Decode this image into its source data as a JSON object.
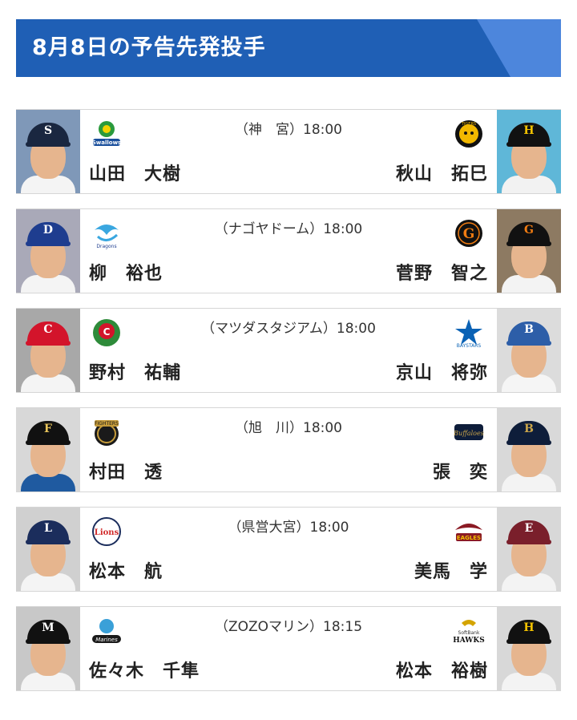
{
  "header": {
    "title": "8月8日の予告先発投手"
  },
  "games": [
    {
      "venue": "（神　宮）18:00",
      "home": {
        "pitcher": "山田　大樹",
        "team_icon": "swallows-logo-icon",
        "cap": "#1a2740",
        "cap_mark": "S",
        "mark": "#ffffff",
        "shirt": "#f4f4f4",
        "bg": "#7f98b8",
        "logo_color": "#2a9a3c"
      },
      "away": {
        "pitcher": "秋山　拓巳",
        "team_icon": "tigers-logo-icon",
        "cap": "#111111",
        "cap_mark": "H",
        "mark": "#f2c200",
        "shirt": "#f2f2f2",
        "bg": "#5fb7d8",
        "logo_color": "#f2b800"
      }
    },
    {
      "venue": "（ナゴヤドーム）18:00",
      "home": {
        "pitcher": "柳　裕也",
        "team_icon": "dragons-logo-icon",
        "cap": "#1e3d8f",
        "cap_mark": "D",
        "mark": "#ffffff",
        "shirt": "#f4f4f4",
        "bg": "#a9a9b8",
        "logo_color": "#3aa7e0"
      },
      "away": {
        "pitcher": "菅野　智之",
        "team_icon": "giants-logo-icon",
        "cap": "#111111",
        "cap_mark": "G",
        "mark": "#f07c12",
        "shirt": "#f3f3f3",
        "bg": "#8d7a62",
        "logo_color": "#f07c12"
      }
    },
    {
      "venue": "（マツダスタジアム）18:00",
      "home": {
        "pitcher": "野村　祐輔",
        "team_icon": "carp-logo-icon",
        "cap": "#d3142b",
        "cap_mark": "C",
        "mark": "#ffffff",
        "shirt": "#f4f4f4",
        "bg": "#a8a8a8",
        "logo_color": "#d3142b"
      },
      "away": {
        "pitcher": "京山　将弥",
        "team_icon": "baystars-logo-icon",
        "cap": "#2d5ea8",
        "cap_mark": "B",
        "mark": "#ffffff",
        "shirt": "#f5f5f5",
        "bg": "#dcdcdc",
        "logo_color": "#0a62b5"
      }
    },
    {
      "venue": "（旭　川）18:00",
      "home": {
        "pitcher": "村田　透",
        "team_icon": "fighters-logo-icon",
        "cap": "#111111",
        "cap_mark": "F",
        "mark": "#e7c35a",
        "shirt": "#1f5aa0",
        "bg": "#d8d8d8",
        "logo_color": "#c59b3a"
      },
      "away": {
        "pitcher": "張　奕",
        "team_icon": "buffaloes-logo-icon",
        "cap": "#0e1d3a",
        "cap_mark": "B",
        "mark": "#c9a44a",
        "shirt": "#f3f3f3",
        "bg": "#d9d9d9",
        "logo_color": "#b08a2f"
      }
    },
    {
      "venue": "（県営大宮）18:00",
      "home": {
        "pitcher": "松本　航",
        "team_icon": "lions-logo-icon",
        "cap": "#1b2d5c",
        "cap_mark": "L",
        "mark": "#ffffff",
        "shirt": "#f4f4f4",
        "bg": "#d0d0d0",
        "logo_color": "#d12a2a"
      },
      "away": {
        "pitcher": "美馬　学",
        "team_icon": "eagles-logo-icon",
        "cap": "#7a1f2b",
        "cap_mark": "E",
        "mark": "#ffffff",
        "shirt": "#f3f3f3",
        "bg": "#d8d8d8",
        "logo_color": "#8b1a24"
      }
    },
    {
      "venue": "（ZOZOマリン）18:15",
      "home": {
        "pitcher": "佐々木　千隼",
        "team_icon": "marines-logo-icon",
        "cap": "#111111",
        "cap_mark": "M",
        "mark": "#ffffff",
        "shirt": "#f4f4f4",
        "bg": "#c8c8c8",
        "logo_color": "#1a1a1a"
      },
      "away": {
        "pitcher": "松本　裕樹",
        "team_icon": "hawks-logo-icon",
        "cap": "#111111",
        "cap_mark": "H",
        "mark": "#f2c200",
        "shirt": "#f3f3f3",
        "bg": "#d8d8d8",
        "logo_color": "#d4a400"
      }
    }
  ],
  "logo_text": {
    "swallows": "Swallows",
    "tigers": "TIGERS",
    "dragons": "Dragons",
    "giants": "G",
    "carp": "C",
    "baystars": "BAYSTARS",
    "fighters": "FIGHTERS",
    "buffaloes": "Buffaloes",
    "lions": "Lions",
    "eagles": "EAGLES",
    "marines": "Marines",
    "hawks_1": "SoftBank",
    "hawks_2": "HAWKS"
  }
}
